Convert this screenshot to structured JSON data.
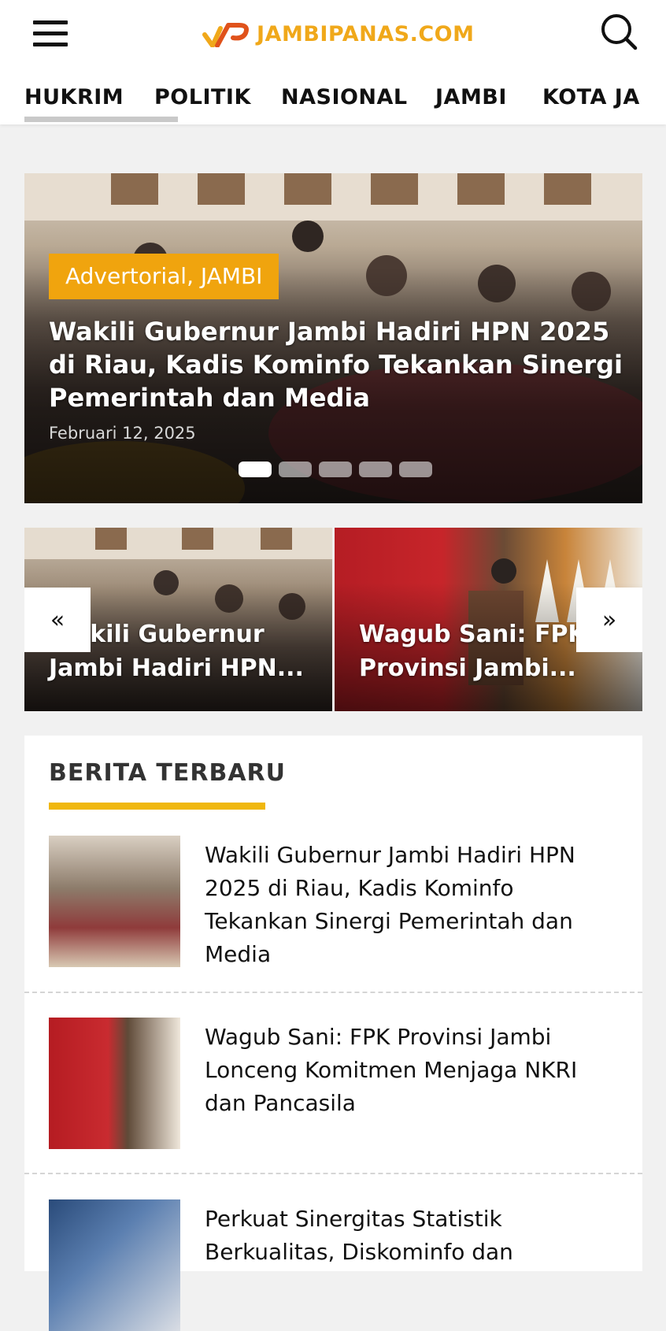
{
  "header": {
    "logo_text": "JAMBIPANAS.COM",
    "brand_color": "#f0a81a",
    "menu_icon": "hamburger-icon",
    "search_icon": "search-icon"
  },
  "nav": {
    "items": [
      {
        "label": "HUKRIM"
      },
      {
        "label": "POLITIK"
      },
      {
        "label": "NASIONAL"
      },
      {
        "label": "JAMBI"
      },
      {
        "label": "KOTA JAMBI"
      }
    ]
  },
  "hero": {
    "category": "Advertorial, JAMBI",
    "title": "Wakili Gubernur Jambi Hadiri HPN 2025 di Riau, Kadis Kominfo Tekankan Sinergi Pemerintah dan Media",
    "date": "Februari 12, 2025",
    "slide_count": 5,
    "active_slide": 1
  },
  "carousel": {
    "prev": "«",
    "next": "»",
    "cards": [
      {
        "title": "Wakili Gubernur Jambi Hadiri HPN..."
      },
      {
        "title": "Wagub Sani: FPK Provinsi Jambi..."
      }
    ]
  },
  "latest": {
    "heading": "BERITA TERBARU",
    "accent": "#f0b70e",
    "items": [
      {
        "title": "Wakili Gubernur Jambi Hadiri HPN 2025 di Riau, Kadis Kominfo Tekankan Sinergi Pemerintah dan Media"
      },
      {
        "title": "Wagub Sani: FPK Provinsi Jambi Lonceng Komitmen Menjaga NKRI dan Pancasila"
      },
      {
        "title": "Perkuat Sinergitas Statistik Berkualitas, Diskominfo dan"
      }
    ]
  }
}
